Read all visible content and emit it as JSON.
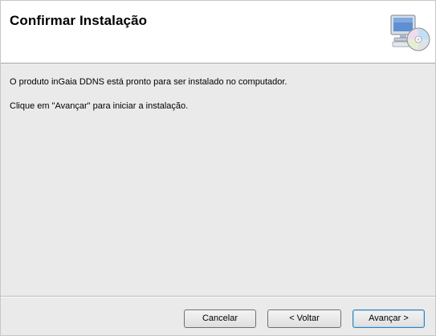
{
  "header": {
    "title": "Confirmar Instalação",
    "icon": "computer-cd-icon"
  },
  "content": {
    "line1": "O produto inGaia DDNS está pronto para ser instalado no computador.",
    "line2": "Clique em \"Avançar\" para iniciar a instalação."
  },
  "buttons": {
    "cancel": "Cancelar",
    "back": "< Voltar",
    "next": "Avançar >"
  }
}
